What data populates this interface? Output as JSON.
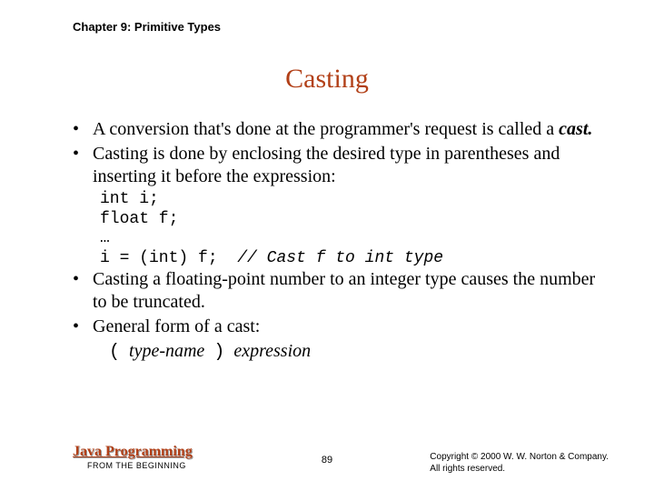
{
  "header": {
    "chapter": "Chapter 9: Primitive Types"
  },
  "title": "Casting",
  "bullets": {
    "b1_part1": "A conversion that's done at the programmer's request is called a ",
    "b1_cast": "cast.",
    "b2": "Casting is done by enclosing the desired type in parentheses and inserting it before the expression:",
    "b3": "Casting a floating-point number to an integer type causes the number to be truncated.",
    "b4": "General form of a cast:"
  },
  "code": {
    "line1": "int i;",
    "line2": "float f;",
    "line3": "…",
    "line4a": "i = (int) f;  ",
    "line4b": "// Cast f to int type"
  },
  "castform": {
    "lp": "(",
    "typename": "type-name",
    "rp": ")",
    "expression": "expression"
  },
  "footer": {
    "book": "Java Programming",
    "sub": "FROM THE BEGINNING",
    "page": "89",
    "copy1": "Copyright © 2000 W. W. Norton & Company.",
    "copy2": "All rights reserved."
  }
}
